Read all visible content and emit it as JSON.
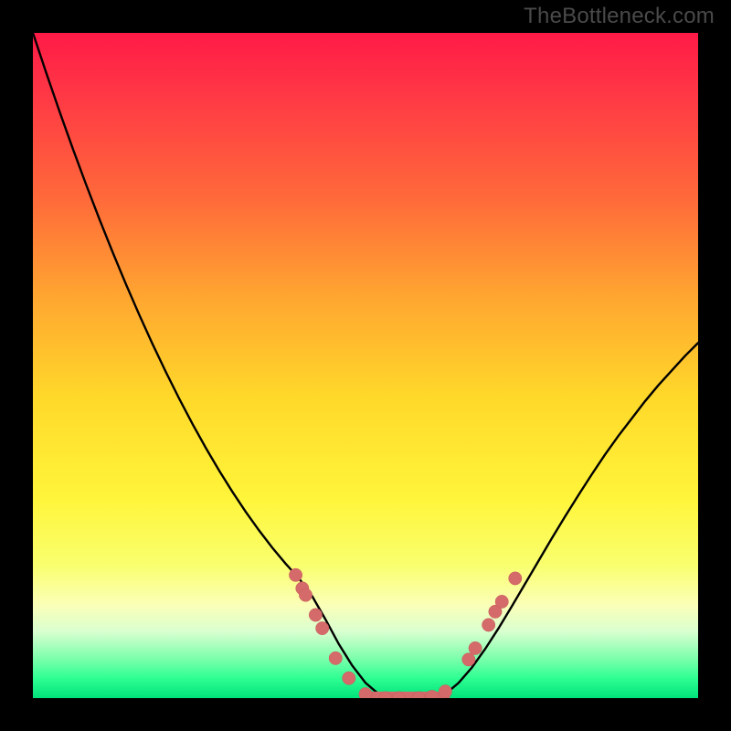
{
  "watermark": "TheBottleneck.com",
  "colors": {
    "frame": "#000000",
    "curve": "#000000",
    "marker_fill": "#d46a6a",
    "marker_stroke": "#c95b5b",
    "gradient_top": "#ff1a47",
    "gradient_bottom": "#00e27a"
  },
  "chart_data": {
    "type": "line",
    "title": "",
    "xlabel": "",
    "ylabel": "",
    "xlim": [
      0,
      100
    ],
    "ylim": [
      0,
      100
    ],
    "x": [
      0,
      2,
      4,
      6,
      8,
      10,
      12,
      14,
      16,
      18,
      20,
      22,
      24,
      26,
      28,
      30,
      32,
      34,
      36,
      38,
      40,
      42,
      44,
      46,
      48,
      50,
      52,
      54,
      56,
      58,
      60,
      62,
      64,
      66,
      68,
      70,
      72,
      74,
      76,
      78,
      80,
      82,
      84,
      86,
      88,
      90,
      92,
      94,
      96,
      98,
      100
    ],
    "y": [
      100,
      94.0,
      88.2,
      82.6,
      77.2,
      72.0,
      67.0,
      62.2,
      57.6,
      53.2,
      49.0,
      45.0,
      41.2,
      37.6,
      34.2,
      31.0,
      28.0,
      25.2,
      22.6,
      20.2,
      18.0,
      15.3,
      11.8,
      8.1,
      4.9,
      2.3,
      0.6,
      0.0,
      0.0,
      0.0,
      0.0,
      0.6,
      2.3,
      4.6,
      7.4,
      10.5,
      13.8,
      17.2,
      20.6,
      24.0,
      27.3,
      30.5,
      33.6,
      36.6,
      39.4,
      42.0,
      44.6,
      47.0,
      49.2,
      51.4,
      53.4
    ],
    "markers": [
      {
        "x": 39.5,
        "y": 18.5
      },
      {
        "x": 40.5,
        "y": 16.5
      },
      {
        "x": 41.0,
        "y": 15.5
      },
      {
        "x": 42.5,
        "y": 12.5
      },
      {
        "x": 43.5,
        "y": 10.5
      },
      {
        "x": 45.5,
        "y": 6.0
      },
      {
        "x": 47.5,
        "y": 3.0
      },
      {
        "x": 50.0,
        "y": 0.6
      },
      {
        "x": 53.0,
        "y": 0.0
      },
      {
        "x": 55.0,
        "y": 0.0
      },
      {
        "x": 58.0,
        "y": 0.0
      },
      {
        "x": 60.0,
        "y": 0.2
      },
      {
        "x": 62.0,
        "y": 1.0
      },
      {
        "x": 65.5,
        "y": 5.8
      },
      {
        "x": 66.5,
        "y": 7.5
      },
      {
        "x": 68.5,
        "y": 11.0
      },
      {
        "x": 69.5,
        "y": 13.0
      },
      {
        "x": 70.5,
        "y": 14.5
      },
      {
        "x": 72.5,
        "y": 18.0
      }
    ],
    "trough_segment": {
      "x0": 50,
      "x1": 62,
      "y": 0.3
    }
  }
}
